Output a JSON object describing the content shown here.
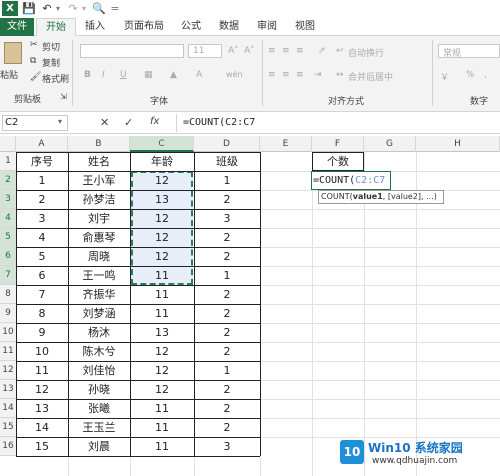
{
  "quick_access": {
    "app_icon": "excel-icon",
    "save_icon": "save-icon",
    "undo_icon": "undo-icon",
    "redo_icon": "redo-icon",
    "preview_icon": "print-preview-icon",
    "more": "="
  },
  "tabs": [
    "文件",
    "开始",
    "插入",
    "页面布局",
    "公式",
    "数据",
    "审阅",
    "视图"
  ],
  "ribbon": {
    "paste": "粘贴",
    "cut": "剪切",
    "copy": "复制",
    "format_painter": "格式刷",
    "clipboard": "剪贴板",
    "font_size": "11",
    "font_group": "字体",
    "bold": "B",
    "italic": "I",
    "underline": "U",
    "phonetic": "wén",
    "wrap": "自动换行",
    "merge": "合并后居中",
    "align_group": "对齐方式",
    "number_format": "常规",
    "currency": "￥",
    "percent": "%",
    "comma": ",",
    "number_group": "数字"
  },
  "formula_bar": {
    "name_box": "C2",
    "cancel": "✕",
    "enter": "✓",
    "fx": "fx",
    "formula": "=COUNT(C2:C7"
  },
  "columns": [
    "A",
    "B",
    "C",
    "D",
    "E",
    "F",
    "G",
    "H"
  ],
  "rows": [
    "1",
    "2",
    "3",
    "4",
    "5",
    "6",
    "7",
    "8",
    "9",
    "10",
    "11",
    "12",
    "13",
    "14",
    "15",
    "16"
  ],
  "headers": {
    "a": "序号",
    "b": "姓名",
    "c": "年龄",
    "d": "班级",
    "f": "个数"
  },
  "table": [
    [
      "1",
      "王小军",
      "12",
      "1"
    ],
    [
      "2",
      "孙梦洁",
      "13",
      "2"
    ],
    [
      "3",
      "刘宇",
      "12",
      "3"
    ],
    [
      "4",
      "俞惠琴",
      "12",
      "2"
    ],
    [
      "5",
      "周晓",
      "12",
      "2"
    ],
    [
      "6",
      "王一鸣",
      "11",
      "1"
    ],
    [
      "7",
      "齐振华",
      "11",
      "2"
    ],
    [
      "8",
      "刘梦涵",
      "11",
      "2"
    ],
    [
      "9",
      "杨沐",
      "13",
      "2"
    ],
    [
      "10",
      "陈木兮",
      "12",
      "2"
    ],
    [
      "11",
      "刘佳怡",
      "12",
      "1"
    ],
    [
      "12",
      "孙晓",
      "12",
      "2"
    ],
    [
      "13",
      "张曦",
      "11",
      "2"
    ],
    [
      "14",
      "王玉兰",
      "11",
      "2"
    ],
    [
      "15",
      "刘晨",
      "11",
      "3"
    ]
  ],
  "edit": {
    "prefix": "=COUNT(",
    "ref": "C2:C7"
  },
  "tooltip": {
    "fn": "COUNT(",
    "arg1": "value1",
    ",rest": ", [value2], ...)"
  },
  "watermark": {
    "brand": "Win10 系统家园",
    "url": "www.qdhuajin.com",
    "logo_text": "10"
  }
}
